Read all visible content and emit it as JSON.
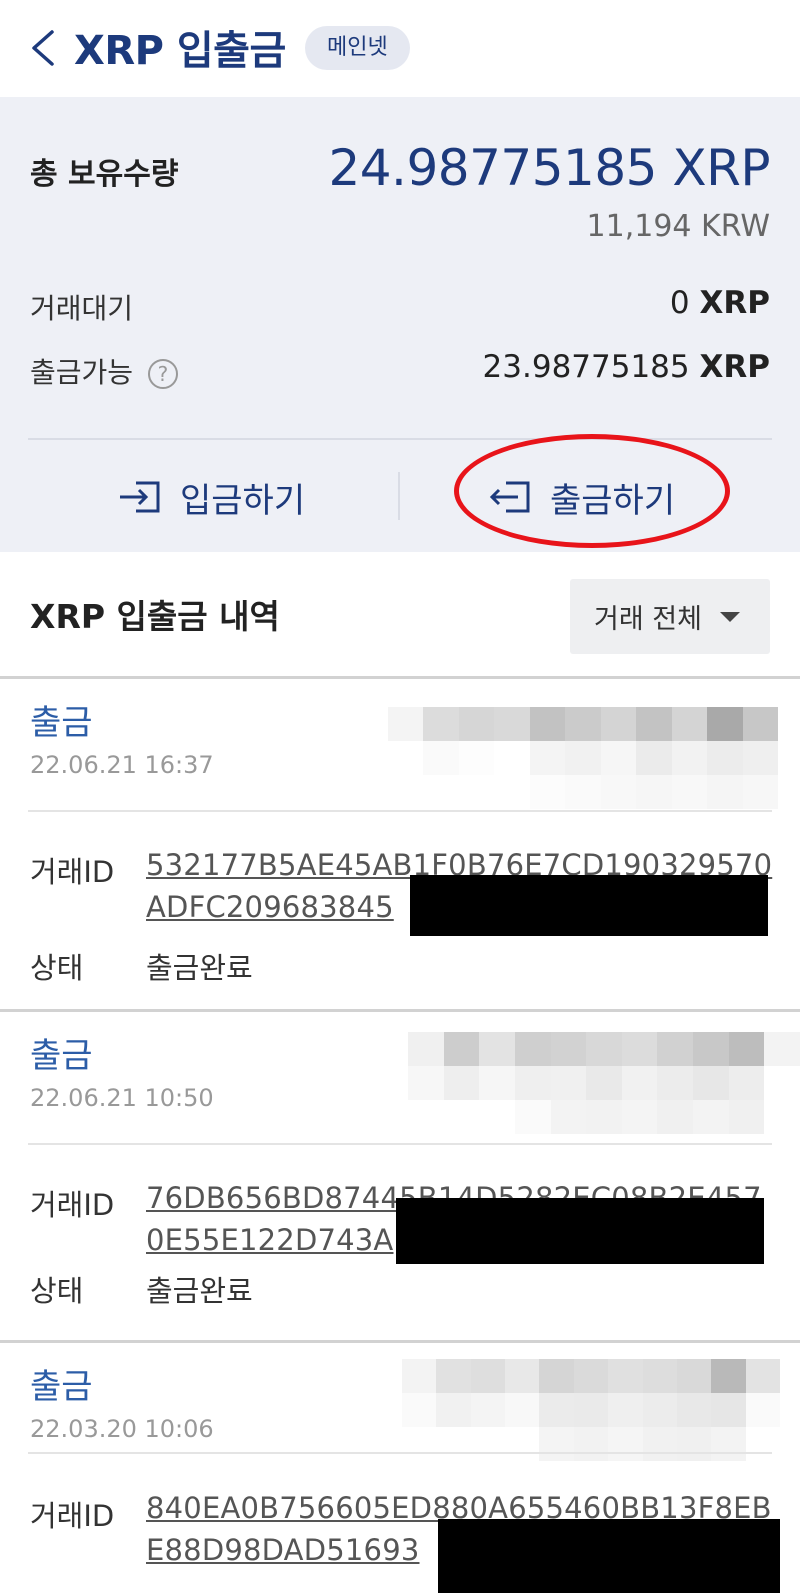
{
  "header": {
    "title": "XRP 입출금",
    "badge": "메인넷"
  },
  "summary": {
    "total_label": "총 보유수량",
    "total_value": "24.98775185 XRP",
    "total_krw": "11,194 KRW",
    "pending_label": "거래대기",
    "pending_amount": "0",
    "pending_unit": "XRP",
    "available_label": "출금가능",
    "available_amount": "23.98775185",
    "available_unit": "XRP",
    "help_glyph": "?",
    "deposit_label": "입금하기",
    "withdraw_label": "출금하기"
  },
  "history": {
    "title": "XRP 입출금 내역",
    "filter_label": "거래 전체",
    "id_label": "거래ID",
    "status_label": "상태",
    "transactions": [
      {
        "type": "출금",
        "date": "22.06.21 16:37",
        "tx_id": "532177B5AE45AB1F0B76E7CD190329570ADFC209683845",
        "status": "출금완료"
      },
      {
        "type": "출금",
        "date": "22.06.21 10:50",
        "tx_id": "76DB656BD87445B14D5282EC08B2E4570E55E122D743A",
        "status": "출금완료"
      },
      {
        "type": "출금",
        "date": "22.03.20 10:06",
        "tx_id": "840EA0B756605ED880A655460BB13F8EBE88D98DAD51693",
        "status": ""
      }
    ]
  },
  "colors": {
    "brand_navy": "#1d3a7c",
    "link_blue": "#2c5da7",
    "highlight_red": "#e8141a",
    "summary_bg": "#eef0f6"
  }
}
